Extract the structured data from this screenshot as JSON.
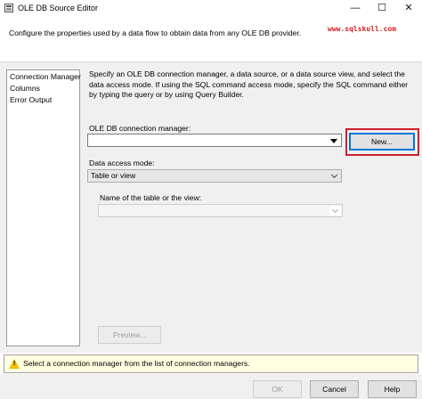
{
  "window": {
    "title": "OLE DB Source Editor",
    "minimize_glyph": "—",
    "maximize_glyph": "☐",
    "close_glyph": "✕"
  },
  "header": {
    "description": "Configure the properties used by a data flow to obtain data from any OLE DB provider.",
    "watermark": "www.sqlskull.com"
  },
  "sidebar": {
    "items": [
      {
        "label": "Connection Manager"
      },
      {
        "label": "Columns"
      },
      {
        "label": "Error Output"
      }
    ]
  },
  "main": {
    "intro": "Specify an OLE DB connection manager, a data source, or a data source view, and select the data access mode. If using the SQL command access mode, specify the SQL command either by typing the query or by using Query Builder.",
    "connection_label": "OLE DB connection manager:",
    "connection_value": "",
    "new_button": "New...",
    "access_mode_label": "Data access mode:",
    "access_mode_value": "Table or view",
    "table_label": "Name of the table or the view:",
    "table_value": "",
    "preview_button": "Preview..."
  },
  "message": {
    "text": "Select a connection manager from the list of connection managers."
  },
  "footer": {
    "ok": "OK",
    "cancel": "Cancel",
    "help": "Help"
  },
  "colors": {
    "highlight": "#d0202f",
    "watermark": "#d62020",
    "message_bg": "#ffffe1"
  }
}
